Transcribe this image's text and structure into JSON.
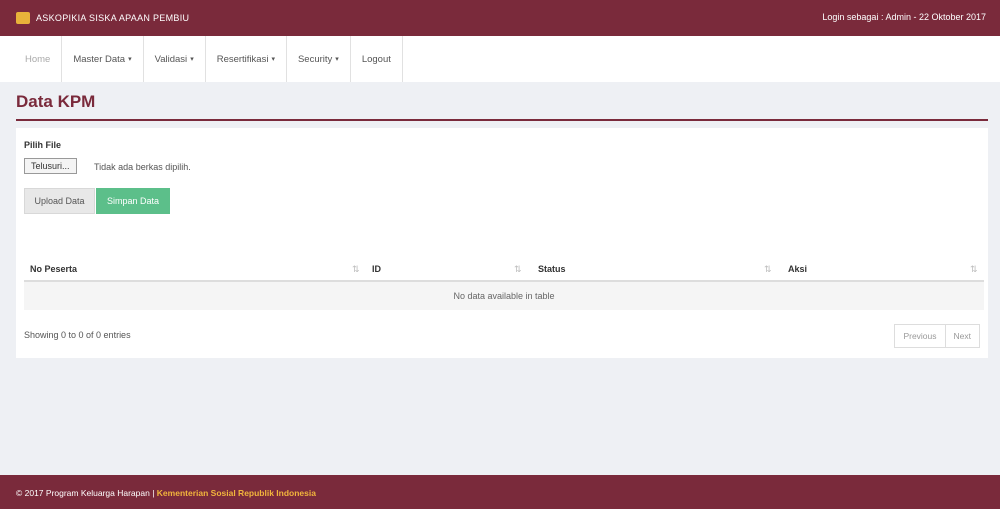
{
  "header": {
    "brand": "ASKOPIKIA SISKA APAAN PEMBIU",
    "login_info": "Login sebagai : Admin - 22 Oktober 2017"
  },
  "nav": {
    "items": [
      {
        "label": "Home",
        "has_caret": false
      },
      {
        "label": "Master Data",
        "has_caret": true
      },
      {
        "label": "Validasi",
        "has_caret": true
      },
      {
        "label": "Resertifikasi",
        "has_caret": true
      },
      {
        "label": "Security",
        "has_caret": true
      },
      {
        "label": "Logout",
        "has_caret": false
      }
    ],
    "caret_glyph": "▾"
  },
  "page": {
    "title": "Data KPM"
  },
  "form": {
    "file_label": "Pilih File",
    "file_button": "Telusuri...",
    "file_status": "Tidak ada berkas dipilih.",
    "upload_button": "Upload Data",
    "save_button": "Simpan Data"
  },
  "table": {
    "columns": [
      "No Peserta",
      "ID",
      "Status",
      "Aksi"
    ],
    "sort_glyph": "⇅",
    "empty_message": "No data available in table",
    "info": "Showing 0 to 0 of 0 entries"
  },
  "pagination": {
    "previous": "Previous",
    "next": "Next"
  },
  "footer": {
    "text": "© 2017 Program Keluarga Harapan |",
    "link": "Kementerian Sosial Republik Indonesia"
  },
  "colors": {
    "brand": "#7a2a3b",
    "accent_green": "#5cbf8a",
    "footer_link": "#f2b53c"
  }
}
